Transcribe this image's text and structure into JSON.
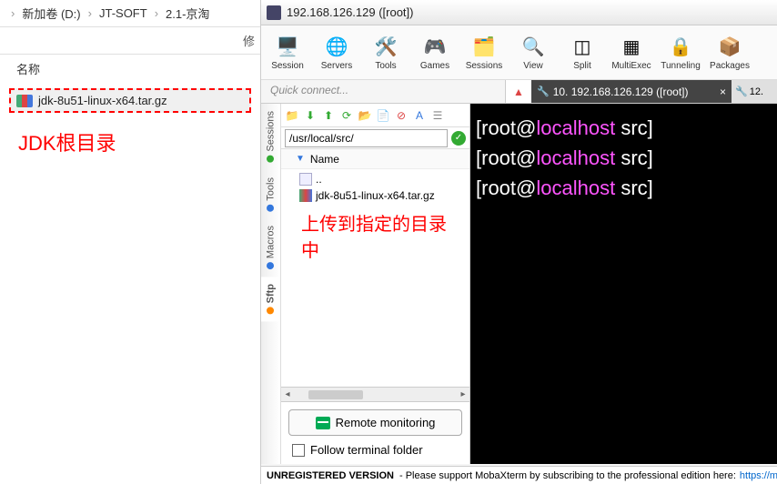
{
  "left": {
    "breadcrumb": [
      "新加卷 (D:)",
      "JT-SOFT",
      "2.1-京淘"
    ],
    "chevron": "›",
    "mod_label": "修",
    "name_header": "名称",
    "file": "jdk-8u51-linux-x64.tar.gz",
    "annotation": "JDK根目录"
  },
  "titlebar": {
    "text": "192.168.126.129 ([root])"
  },
  "toolbar": [
    {
      "icon": "🖥️",
      "label": "Session"
    },
    {
      "icon": "🌐",
      "label": "Servers"
    },
    {
      "icon": "🛠️",
      "label": "Tools"
    },
    {
      "icon": "🎮",
      "label": "Games"
    },
    {
      "icon": "🗂️",
      "label": "Sessions"
    },
    {
      "icon": "🔍",
      "label": "View"
    },
    {
      "icon": "◫",
      "label": "Split"
    },
    {
      "icon": "▦",
      "label": "MultiExec"
    },
    {
      "icon": "🔒",
      "label": "Tunneling"
    },
    {
      "icon": "📦",
      "label": "Packages"
    }
  ],
  "quick": {
    "placeholder": "Quick connect..."
  },
  "tabs": {
    "active": "10. 192.168.126.129 ([root])",
    "inactive": "12."
  },
  "side_tabs": [
    "Sessions",
    "Tools",
    "Macros",
    "Sftp"
  ],
  "sftp": {
    "path": "/usr/local/src/",
    "name_col": "Name",
    "up": "..",
    "file": "jdk-8u51-linux-x64.tar.gz",
    "annotation": "上传到指定的目录中",
    "remote_monitoring": "Remote monitoring",
    "follow": "Follow terminal folder"
  },
  "terminal": {
    "lines": [
      {
        "user": "root",
        "at": "@",
        "host": "localhost",
        "rest": " src]"
      },
      {
        "user": "root",
        "at": "@",
        "host": "localhost",
        "rest": " src]"
      },
      {
        "user": "root",
        "at": "@",
        "host": "localhost",
        "rest": " src]"
      }
    ],
    "open": "["
  },
  "footer": {
    "bold": "UNREGISTERED VERSION",
    "text": " - Please support MobaXterm by subscribing to the professional edition here: ",
    "link": "https://mob"
  }
}
